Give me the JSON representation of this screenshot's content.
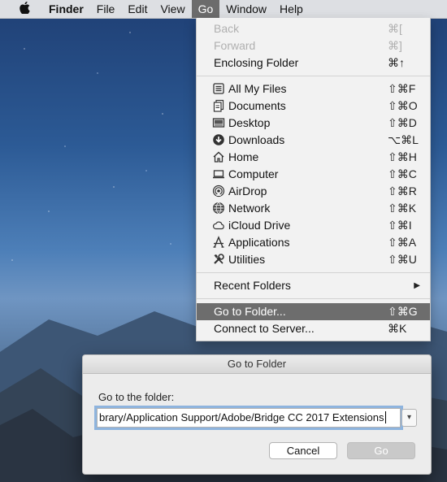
{
  "menubar": {
    "app": "Finder",
    "items": [
      "File",
      "Edit",
      "View",
      "Go",
      "Window",
      "Help"
    ]
  },
  "go_menu": {
    "top": [
      {
        "label": "Back",
        "shortcut": "⌘[",
        "disabled": true
      },
      {
        "label": "Forward",
        "shortcut": "⌘]",
        "disabled": true
      },
      {
        "label": "Enclosing Folder",
        "shortcut": "⌘↑",
        "disabled": false
      }
    ],
    "places": [
      {
        "label": "All My Files",
        "shortcut": "⇧⌘F",
        "icon": "all-files-icon"
      },
      {
        "label": "Documents",
        "shortcut": "⇧⌘O",
        "icon": "documents-icon"
      },
      {
        "label": "Desktop",
        "shortcut": "⇧⌘D",
        "icon": "desktop-icon"
      },
      {
        "label": "Downloads",
        "shortcut": "⌥⌘L",
        "icon": "downloads-icon"
      },
      {
        "label": "Home",
        "shortcut": "⇧⌘H",
        "icon": "home-icon"
      },
      {
        "label": "Computer",
        "shortcut": "⇧⌘C",
        "icon": "computer-icon"
      },
      {
        "label": "AirDrop",
        "shortcut": "⇧⌘R",
        "icon": "airdrop-icon"
      },
      {
        "label": "Network",
        "shortcut": "⇧⌘K",
        "icon": "network-icon"
      },
      {
        "label": "iCloud Drive",
        "shortcut": "⇧⌘I",
        "icon": "icloud-icon"
      },
      {
        "label": "Applications",
        "shortcut": "⇧⌘A",
        "icon": "applications-icon"
      },
      {
        "label": "Utilities",
        "shortcut": "⇧⌘U",
        "icon": "utilities-icon"
      }
    ],
    "recent_folders": "Recent Folders",
    "bottom": [
      {
        "label": "Go to Folder...",
        "shortcut": "⇧⌘G",
        "highlighted": true
      },
      {
        "label": "Connect to Server...",
        "shortcut": "⌘K",
        "highlighted": false
      }
    ]
  },
  "dialog": {
    "title": "Go to Folder",
    "prompt": "Go to the folder:",
    "path_value": "brary/Application Support/Adobe/Bridge CC 2017 Extensions",
    "cancel_label": "Cancel",
    "go_label": "Go"
  },
  "colors": {
    "menu_highlight": "#6d6d6d",
    "focus_ring": "#6fa1da"
  }
}
